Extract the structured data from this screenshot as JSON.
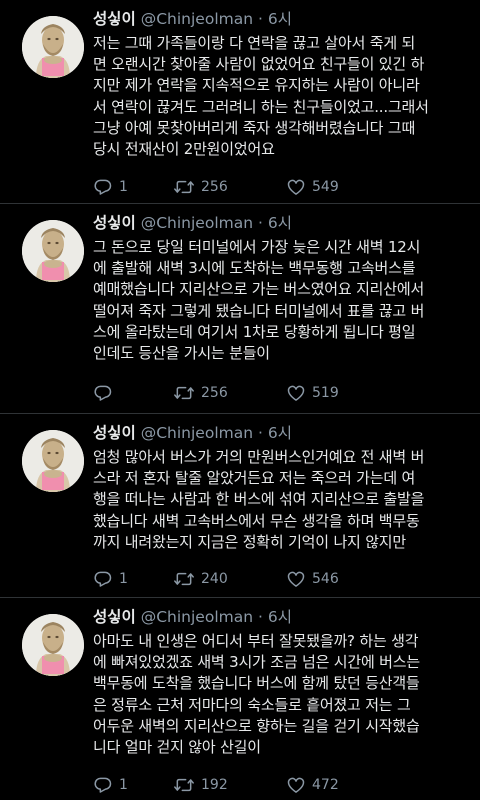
{
  "tweets": [
    {
      "display_name": "성싷이",
      "handle": "@Chinjeolman",
      "separator": "·",
      "time": "6시",
      "lines": [
        "저는 그때 가족들이랑 다 연락을 끊고 살아서 죽게 되",
        "면 오랜시간 찾아줄 사람이 없었어요 친구들이 있긴 하",
        "지만 제가 연락을 지속적으로 유지하는 사람이 아니라",
        "서 연락이 끊겨도 그러려니 하는 친구들이었고...그래서",
        "그냥 아예 못찾아버리게 죽자 생각해버렸습니다 그때",
        "당시 전재산이 2만원이었어요"
      ],
      "replies": "1",
      "retweets": "256",
      "likes": "549"
    },
    {
      "display_name": "성싷이",
      "handle": "@Chinjeolman",
      "separator": "·",
      "time": "6시",
      "lines": [
        "그 돈으로 당일 터미널에서 가장 늦은 시간 새벽 12시",
        "에 출발해 새벽 3시에 도착하는 백무동행 고속버스를",
        "예매했습니다 지리산으로 가는 버스였어요 지리산에서",
        "떨어져 죽자 그렇게 됐습니다 터미널에서 표를 끊고 버",
        "스에 올라탔는데 여기서 1차로 당황하게 됩니다 평일",
        "인데도 등산을 가시는 분들이"
      ],
      "replies": "",
      "retweets": "256",
      "likes": "519"
    },
    {
      "display_name": "성싷이",
      "handle": "@Chinjeolman",
      "separator": "·",
      "time": "6시",
      "lines": [
        "엄청 많아서 버스가 거의 만원버스인거예요 전 새벽 버",
        "스라 저 혼자 탈줄 알았거든요 저는 죽으러 가는데 여",
        "행을 떠나는 사람과 한 버스에 섞여 지리산으로 출발을",
        "했습니다 새벽 고속버스에서 무슨 생각을 하며 백무동",
        "까지 내려왔는지 지금은 정확히 기억이 나지 않지만"
      ],
      "replies": "1",
      "retweets": "240",
      "likes": "546"
    },
    {
      "display_name": "성싷이",
      "handle": "@Chinjeolman",
      "separator": "·",
      "time": "6시",
      "lines": [
        "아마도 내 인생은 어디서 부터 잘못됐을까? 하는 생각",
        "에 빠져있었겠죠 새벽 3시가 조금 넘은 시간에 버스는",
        "백무동에 도착을 했습니다 버스에 함께 탔던 등산객들",
        "은 정류소 근처 저마다의 숙소들로 흩어졌고 저는 그",
        "어두운 새벽의 지리산으로 향하는 길을 걷기 시작했습",
        "니다 얼마 걷지 않아 산길이"
      ],
      "replies": "1",
      "retweets": "192",
      "likes": "472"
    }
  ]
}
